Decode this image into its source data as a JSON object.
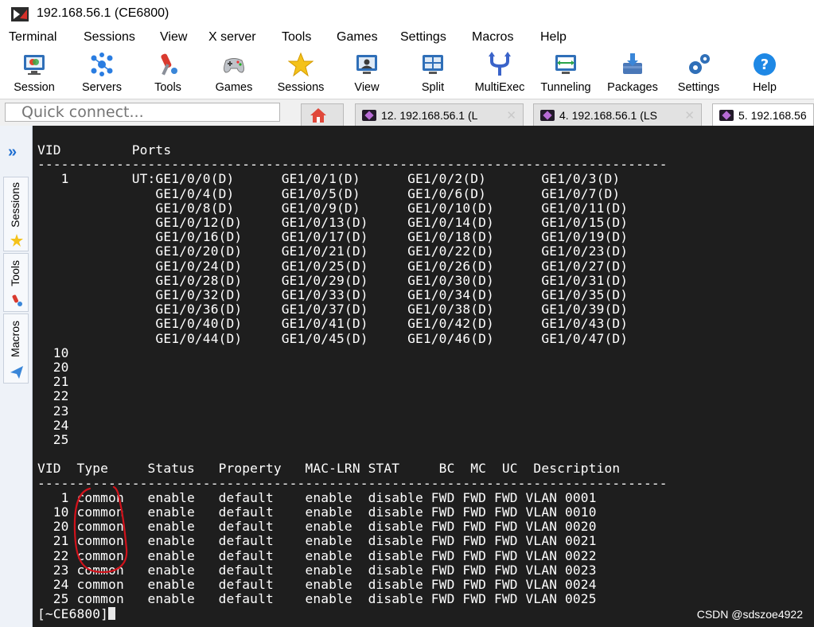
{
  "window": {
    "title": "192.168.56.1 (CE6800)"
  },
  "menu": [
    "Terminal",
    "Sessions",
    "View",
    "X server",
    "Tools",
    "Games",
    "Settings",
    "Macros",
    "Help"
  ],
  "toolbar": [
    {
      "label": "Session",
      "icon": "session-icon"
    },
    {
      "label": "Servers",
      "icon": "servers-icon"
    },
    {
      "label": "Tools",
      "icon": "tools-icon"
    },
    {
      "label": "Games",
      "icon": "games-icon"
    },
    {
      "label": "Sessions",
      "icon": "star-icon"
    },
    {
      "label": "View",
      "icon": "view-icon"
    },
    {
      "label": "Split",
      "icon": "split-icon"
    },
    {
      "label": "MultiExec",
      "icon": "multiexec-icon"
    },
    {
      "label": "Tunneling",
      "icon": "tunneling-icon"
    },
    {
      "label": "Packages",
      "icon": "packages-icon"
    },
    {
      "label": "Settings",
      "icon": "settings-icon"
    },
    {
      "label": "Help",
      "icon": "help-icon"
    }
  ],
  "quick_connect": {
    "placeholder": "Quick connect..."
  },
  "tabs": [
    {
      "label": "12. 192.168.56.1 (L"
    },
    {
      "label": "4. 192.168.56.1 (LS"
    },
    {
      "label": "5. 192.168.56"
    }
  ],
  "sidebar": {
    "tabs": [
      "Sessions",
      "Tools",
      "Macros"
    ]
  },
  "terminal": {
    "lines": [
      "VID         Ports",
      "--------------------------------------------------------------------------------",
      "   1        UT:GE1/0/0(D)      GE1/0/1(D)      GE1/0/2(D)       GE1/0/3(D)",
      "               GE1/0/4(D)      GE1/0/5(D)      GE1/0/6(D)       GE1/0/7(D)",
      "               GE1/0/8(D)      GE1/0/9(D)      GE1/0/10(D)      GE1/0/11(D)",
      "               GE1/0/12(D)     GE1/0/13(D)     GE1/0/14(D)      GE1/0/15(D)",
      "               GE1/0/16(D)     GE1/0/17(D)     GE1/0/18(D)      GE1/0/19(D)",
      "               GE1/0/20(D)     GE1/0/21(D)     GE1/0/22(D)      GE1/0/23(D)",
      "               GE1/0/24(D)     GE1/0/25(D)     GE1/0/26(D)      GE1/0/27(D)",
      "               GE1/0/28(D)     GE1/0/29(D)     GE1/0/30(D)      GE1/0/31(D)",
      "               GE1/0/32(D)     GE1/0/33(D)     GE1/0/34(D)      GE1/0/35(D)",
      "               GE1/0/36(D)     GE1/0/37(D)     GE1/0/38(D)      GE1/0/39(D)",
      "               GE1/0/40(D)     GE1/0/41(D)     GE1/0/42(D)      GE1/0/43(D)",
      "               GE1/0/44(D)     GE1/0/45(D)     GE1/0/46(D)      GE1/0/47(D)",
      "  10",
      "  20",
      "  21",
      "  22",
      "  23",
      "  24",
      "  25",
      "",
      "VID  Type     Status   Property   MAC-LRN STAT     BC  MC  UC  Description",
      "--------------------------------------------------------------------------------",
      "   1 common   enable   default    enable  disable FWD FWD FWD VLAN 0001",
      "  10 common   enable   default    enable  disable FWD FWD FWD VLAN 0010",
      "  20 common   enable   default    enable  disable FWD FWD FWD VLAN 0020",
      "  21 common   enable   default    enable  disable FWD FWD FWD VLAN 0021",
      "  22 common   enable   default    enable  disable FWD FWD FWD VLAN 0022",
      "  23 common   enable   default    enable  disable FWD FWD FWD VLAN 0023",
      "  24 common   enable   default    enable  disable FWD FWD FWD VLAN 0024",
      "  25 common   enable   default    enable  disable FWD FWD FWD VLAN 0025"
    ],
    "prompt": "[~CE6800]"
  },
  "watermark": "CSDN @sdszoe4922",
  "colors": {
    "terminal_bg": "#1e1e1e",
    "terminal_fg": "#ffffff",
    "annotation": "#d0121b",
    "accent": "#1f6fd1"
  }
}
